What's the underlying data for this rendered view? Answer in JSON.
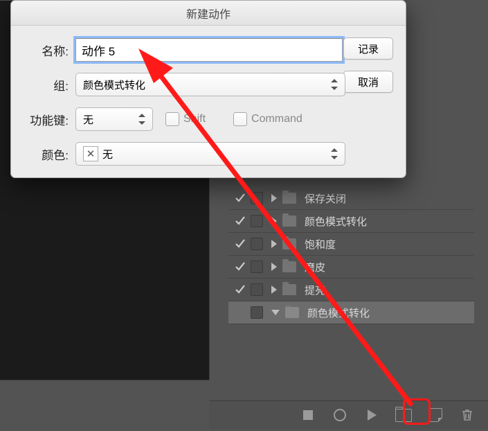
{
  "dialog": {
    "title": "新建动作",
    "name_label": "名称:",
    "name_value": "动作 5",
    "set_label": "组:",
    "set_value": "颜色模式转化",
    "fn_label": "功能键:",
    "fn_value": "无",
    "shift_label": "Shift",
    "command_label": "Command",
    "color_label": "颜色:",
    "color_value": "无",
    "record_btn": "记录",
    "cancel_btn": "取消"
  },
  "actions_panel": {
    "rows": [
      {
        "label": "保存关闭",
        "checked": true,
        "selected": false,
        "expanded": false
      },
      {
        "label": "颜色模式转化",
        "checked": true,
        "selected": false,
        "expanded": false
      },
      {
        "label": "饱和度",
        "checked": true,
        "selected": false,
        "expanded": false
      },
      {
        "label": "磨皮",
        "checked": true,
        "selected": false,
        "expanded": false
      },
      {
        "label": "提亮",
        "checked": true,
        "selected": false,
        "expanded": false
      },
      {
        "label": "颜色模式转化",
        "checked": false,
        "selected": true,
        "expanded": true
      }
    ]
  },
  "bottom_bar": {
    "icons": [
      "stop",
      "record",
      "play",
      "new-set",
      "new-action",
      "delete"
    ]
  }
}
